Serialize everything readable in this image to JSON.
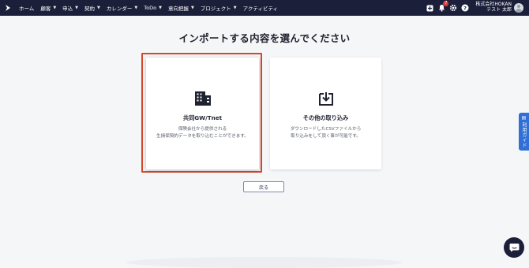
{
  "nav": {
    "items": [
      {
        "label": "ホーム",
        "has_menu": false
      },
      {
        "label": "顧客",
        "has_menu": true
      },
      {
        "label": "申込",
        "has_menu": true
      },
      {
        "label": "契約",
        "has_menu": true
      },
      {
        "label": "カレンダー",
        "has_menu": true
      },
      {
        "label": "ToDo",
        "has_menu": true
      },
      {
        "label": "意向把握",
        "has_menu": true
      },
      {
        "label": "プロジェクト",
        "has_menu": true
      },
      {
        "label": "アクティビティ",
        "has_menu": false
      }
    ],
    "notification_count": "7",
    "user_company": "株式会社HOKAN",
    "user_name": "テスト 太郎"
  },
  "page": {
    "title": "インポートする内容を選んでください"
  },
  "cards": [
    {
      "title": "共同GW/Tnet",
      "desc_line1": "保険会社から提供される",
      "desc_line2": "生損保契約データを取り込むことができます。",
      "icon": "building-icon"
    },
    {
      "title": "その他の取り込み",
      "desc_line1": "ダウンロードしたCSVファイルから",
      "desc_line2": "取り込みをして頂く事が可能です。",
      "icon": "download-icon"
    }
  ],
  "back_button": "戻る",
  "guide_tab": "利用ガイド",
  "colors": {
    "topbar": "#1b1f3a",
    "highlight": "#d5472a",
    "guide": "#2f6fd6"
  }
}
